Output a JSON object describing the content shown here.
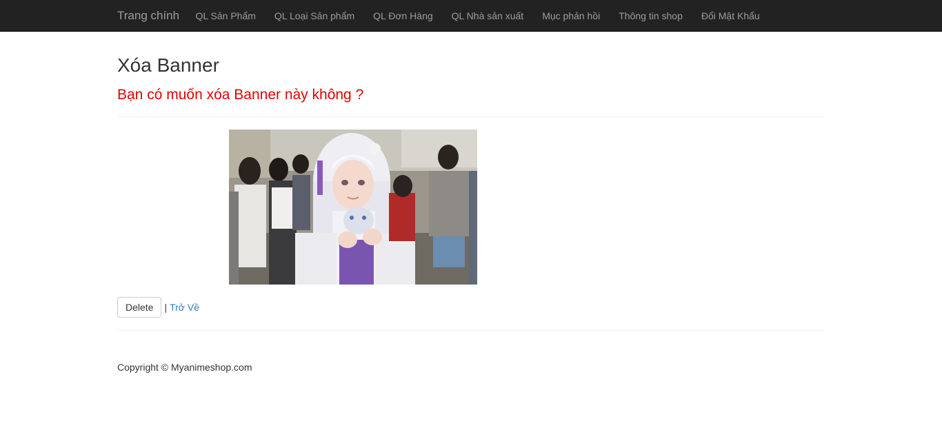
{
  "navbar": {
    "brand": "Trang chính",
    "items": [
      {
        "label": "QL Sản Phẩm"
      },
      {
        "label": "QL Loại Sản phẩm"
      },
      {
        "label": "QL Đơn Hàng"
      },
      {
        "label": "QL Nhà sản xuất"
      },
      {
        "label": "Mục phản hồi"
      },
      {
        "label": "Thông tin shop"
      },
      {
        "label": "Đổi Mật Khẩu"
      }
    ]
  },
  "main": {
    "title": "Xóa Banner",
    "question": "Bạn có muốn xóa Banner này không ?",
    "delete_label": "Delete",
    "separator": "|",
    "back_label": "Trở Về"
  },
  "footer": {
    "copyright": "Copyright © Myanimeshop.com"
  },
  "colors": {
    "navbar_bg": "#222222",
    "question_red": "#e50000",
    "link_blue": "#337ab7"
  }
}
